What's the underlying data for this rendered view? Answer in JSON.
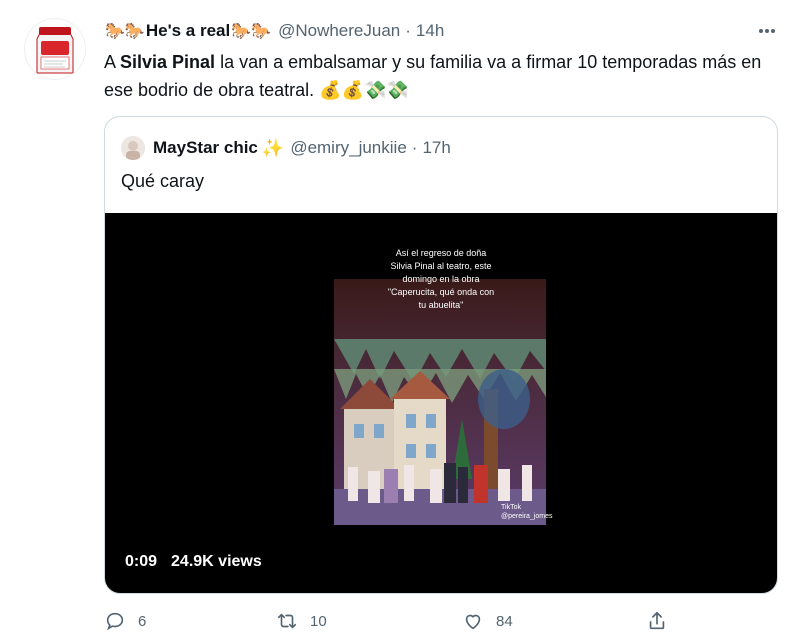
{
  "tweet": {
    "display_name_prefix": "🐎🐎",
    "display_name_text": "He's a real",
    "display_name_suffix": "🐎🐎",
    "handle": "@NowhereJuan",
    "separator": "·",
    "time": "14h",
    "text_before": "A ",
    "text_bold": "Silvia Pinal",
    "text_after": " la van a embalsamar y su familia va a firmar 10 temporadas más en ese bodrio de obra teatral. 💰💰💸💸",
    "avatar_label_top": "MALK",
    "avatar_label_main": "MALK"
  },
  "quote": {
    "display_name": "MayStar chic",
    "sparkle": "✨",
    "handle": "@emiry_junkiie",
    "separator": "·",
    "time": "17h",
    "text": "Qué caray",
    "video": {
      "caption_lines": [
        "Así el regreso de doña",
        "Silvia Pinal al teatro, este",
        "domingo en la obra",
        "\"Caperucita, qué onda con",
        "tu abuelita\""
      ],
      "tiktok_label": "TikTok",
      "tiktok_user": "@pereira_jomes",
      "timestamp": "0:09",
      "views": "24.9K views"
    }
  },
  "actions": {
    "reply_count": "6",
    "retweet_count": "10",
    "like_count": "84"
  }
}
